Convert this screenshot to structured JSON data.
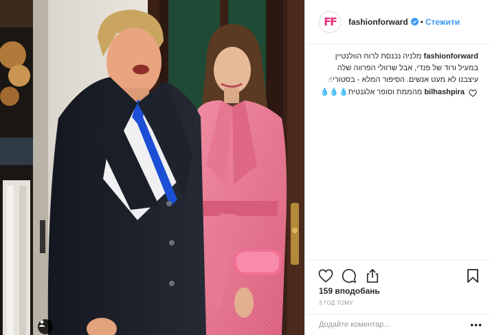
{
  "post": {
    "image_alt": "",
    "username": "fashionforward",
    "avatar_initials": "FF",
    "verified": true,
    "separator": "•",
    "follow_label": "Стежити",
    "caption_prefix": "fashionforward",
    "caption_text": "מלניה נכנסת לרוח הוולנטיין במעיל ורוד של פנדי, אבל שרוולי הפרווה שלה עיצבנו לא מעט אנשים. הסיפור המלא - בסטורי☝",
    "comments": [
      {
        "username": "bilhashpira",
        "text": "מהממת וסופר אלגנטית💧💧💧"
      }
    ],
    "likes_text": "159 вподобань",
    "time_text": "3 ГОД ТОМУ",
    "comment_placeholder": "Додайте коментар...",
    "more_label": "•••"
  },
  "colors": {
    "accent": "#3897f0",
    "brand": "#e8317a",
    "coat_pink": "#e8708a",
    "door": "#3a2016"
  },
  "icons": {
    "like": "heart-icon",
    "comment": "comment-icon",
    "share": "share-icon",
    "save": "bookmark-icon",
    "tag": "user-tag-icon",
    "verified": "verified-badge-icon"
  }
}
